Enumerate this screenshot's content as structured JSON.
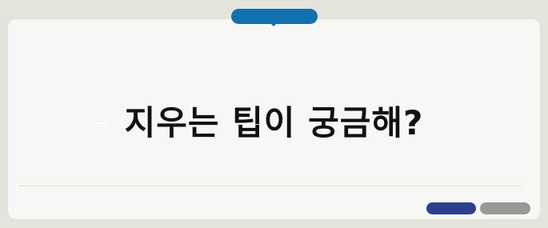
{
  "banner": {
    "title": "지우는 팁이 궁금해?"
  },
  "colors": {
    "background": "#e4e3dc",
    "card": "#f7f7f5",
    "top_pill": "#1170ae",
    "primary_button": "#2c3f8f",
    "secondary_button": "#9a9896",
    "title_text": "#111111"
  },
  "actions": {
    "primary_label": "",
    "secondary_label": ""
  }
}
